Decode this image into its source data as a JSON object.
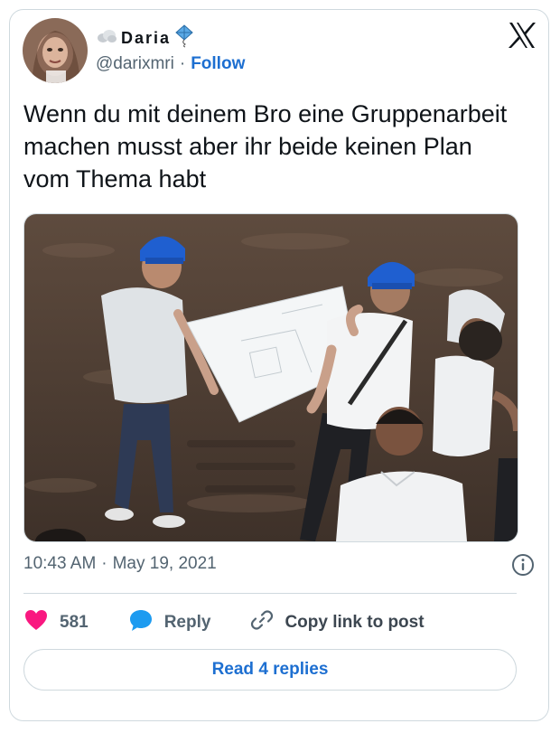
{
  "author": {
    "display_name": "Daria",
    "handle": "@darixmri",
    "separator": "·",
    "follow_label": "Follow"
  },
  "tweet": {
    "text": "Wenn du mit deinem Bro eine Gruppenarbeit machen musst aber ihr beide keinen Plan vom Thema habt",
    "time": "10:43 AM",
    "separator": "·",
    "date": "May 19, 2021"
  },
  "actions": {
    "like_count": "581",
    "reply_label": "Reply",
    "copy_link_label": "Copy link to post"
  },
  "footer": {
    "read_replies_label": "Read 4 replies"
  },
  "icons": {
    "brand": "x-logo-icon",
    "like": "heart-icon",
    "reply": "speech-bubble-icon",
    "copy": "link-icon",
    "info": "info-icon",
    "name_prefix": "cloud-icon",
    "name_suffix": "kite-icon"
  },
  "colors": {
    "accent": "#1d6fd1",
    "like": "#f91880",
    "reply_bubble": "#1d9bf0",
    "muted_text": "#536471",
    "border": "#cfd9de"
  }
}
